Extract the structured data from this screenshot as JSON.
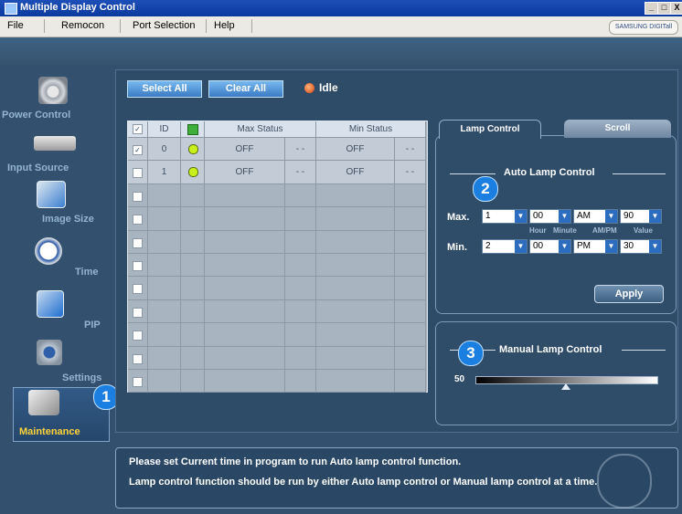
{
  "window": {
    "title": "Multiple Display Control",
    "controls": [
      "_",
      "□",
      "X"
    ]
  },
  "menu": [
    "File",
    "Remocon",
    "Port Selection",
    "Help"
  ],
  "brand": "SAMSUNG DIGITall",
  "nav": [
    {
      "label": "Power Control",
      "icon": "power-icon"
    },
    {
      "label": "Input Source",
      "icon": "input-source-icon"
    },
    {
      "label": "Image Size",
      "icon": "image-size-icon"
    },
    {
      "label": "Time",
      "icon": "clock-icon"
    },
    {
      "label": "PIP",
      "icon": "pip-icon"
    },
    {
      "label": "Settings",
      "icon": "settings-icon"
    },
    {
      "label": "Maintenance",
      "icon": "maintenance-icon",
      "active": true
    }
  ],
  "toolbar": {
    "select_all": "Select All",
    "clear_all": "Clear All",
    "status": "Idle"
  },
  "grid": {
    "headers": [
      "ID",
      "Max Status",
      "Min Status"
    ],
    "rows": [
      {
        "checked": true,
        "id": "0",
        "max": "OFF",
        "max2": "- -",
        "min": "OFF",
        "min2": "- -"
      },
      {
        "checked": false,
        "id": "1",
        "max": "OFF",
        "max2": "- -",
        "min": "OFF",
        "min2": "- -"
      }
    ]
  },
  "tabs": {
    "lamp_control": "Lamp Control",
    "scroll": "Scroll"
  },
  "auto_lamp": {
    "title": "Auto Lamp Control",
    "max_label": "Max.",
    "min_label": "Min.",
    "sub_labels": [
      "Hour",
      "Minute",
      "AM/PM",
      "Value"
    ],
    "max": {
      "hour": "1",
      "minute": "00",
      "ampm": "AM",
      "value": "90"
    },
    "min": {
      "hour": "2",
      "minute": "00",
      "ampm": "PM",
      "value": "30"
    },
    "apply": "Apply"
  },
  "manual_lamp": {
    "title": "Manual Lamp Control",
    "value": "50",
    "level": 0.5
  },
  "badges": [
    "1",
    "2",
    "3"
  ],
  "messages": [
    "Please set Current time in program to run Auto lamp control function.",
    "Lamp control function should be run by either Auto lamp control or Manual lamp control at a time."
  ]
}
